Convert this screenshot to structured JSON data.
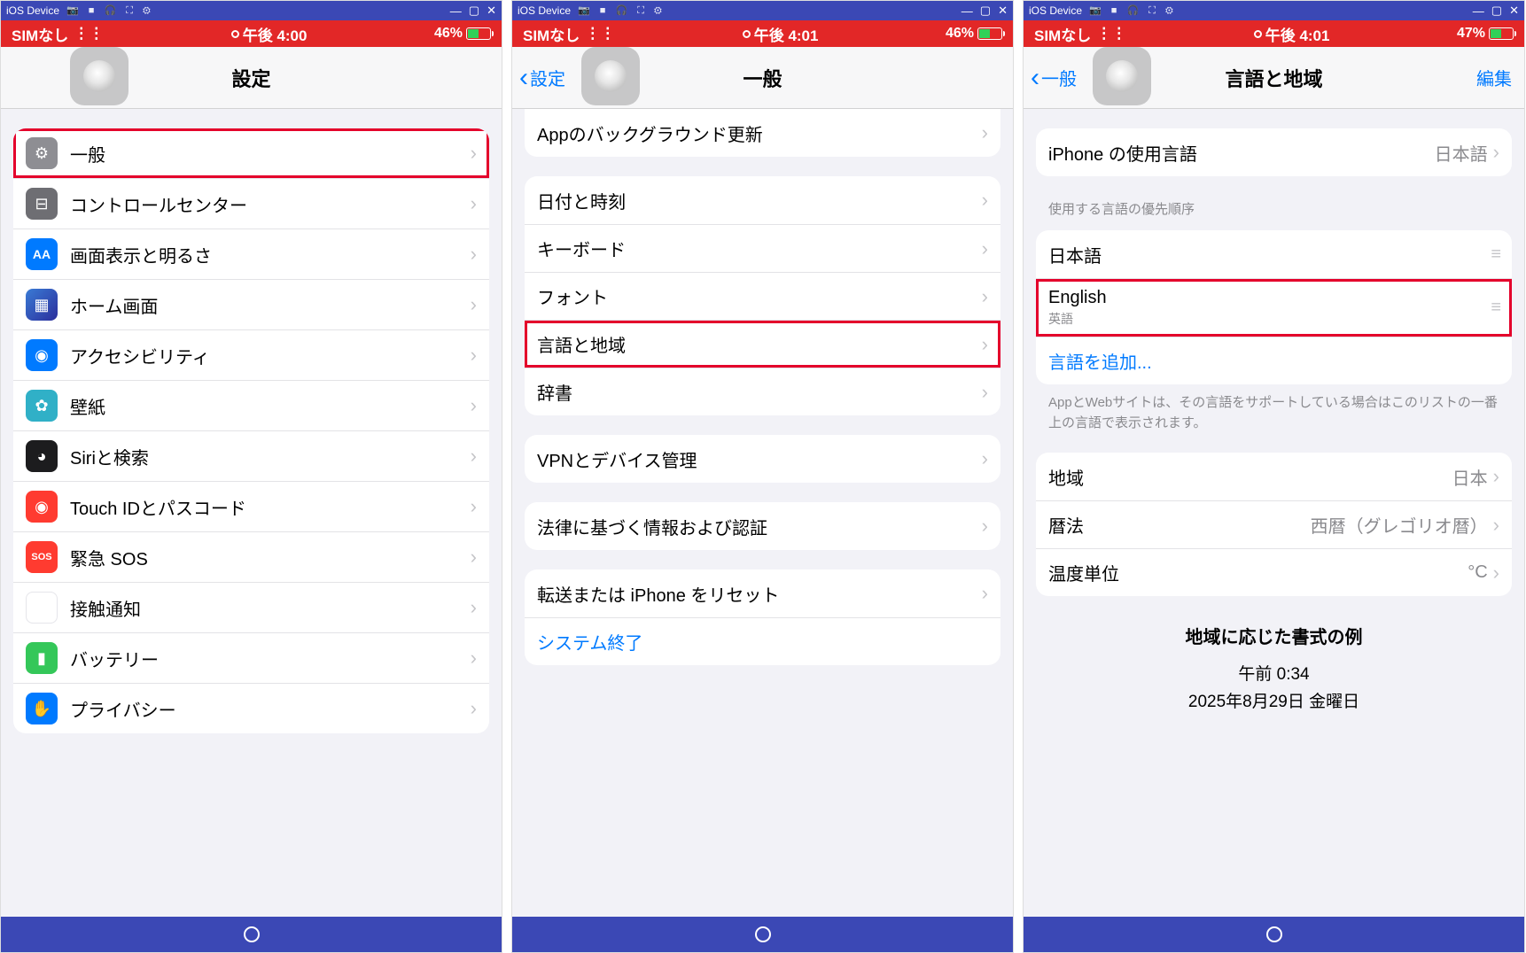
{
  "emulator": {
    "title": "iOS Device",
    "icons_glyphs": "📷 ■ 🎧 ⛶ ⚙",
    "win_min": "—",
    "win_max": "▢",
    "win_close": "✕"
  },
  "device1": {
    "status": {
      "sim": "SIMなし",
      "wifi": "􀙇",
      "time": "午後 4:00",
      "battery": "46%"
    },
    "nav": {
      "title": "設定"
    },
    "rows": [
      {
        "id": "general",
        "label": "一般",
        "icon_bg": "ic-gray",
        "glyph": "⚙",
        "hl": true
      },
      {
        "id": "control-center",
        "label": "コントロールセンター",
        "icon_bg": "ic-darkgray",
        "glyph": "⊟"
      },
      {
        "id": "display",
        "label": "画面表示と明るさ",
        "icon_bg": "ic-blue",
        "glyph": "AA"
      },
      {
        "id": "home-screen",
        "label": "ホーム画面",
        "icon_bg": "ic-apps",
        "glyph": "▦"
      },
      {
        "id": "accessibility",
        "label": "アクセシビリティ",
        "icon_bg": "ic-blue",
        "glyph": "◉"
      },
      {
        "id": "wallpaper",
        "label": "壁紙",
        "icon_bg": "ic-teal",
        "glyph": "✿"
      },
      {
        "id": "siri",
        "label": "Siriと検索",
        "icon_bg": "ic-black",
        "glyph": "◕"
      },
      {
        "id": "touchid",
        "label": "Touch IDとパスコード",
        "icon_bg": "ic-red",
        "glyph": "◉"
      },
      {
        "id": "sos",
        "label": "緊急 SOS",
        "icon_bg": "ic-sosred",
        "glyph": "SOS"
      },
      {
        "id": "exposure",
        "label": "接触通知",
        "icon_bg": "ic-exposure",
        "glyph": "⦿"
      },
      {
        "id": "battery",
        "label": "バッテリー",
        "icon_bg": "ic-green",
        "glyph": "▮"
      },
      {
        "id": "privacy",
        "label": "プライバシー",
        "icon_bg": "ic-blue",
        "glyph": "✋"
      }
    ]
  },
  "device2": {
    "status": {
      "sim": "SIMなし",
      "time": "午後 4:01",
      "battery": "46%"
    },
    "nav": {
      "back": "設定",
      "title": "一般"
    },
    "partial_row": "Appのバックグラウンド更新",
    "groupA": [
      {
        "id": "date-time",
        "label": "日付と時刻"
      },
      {
        "id": "keyboard",
        "label": "キーボード"
      },
      {
        "id": "fonts",
        "label": "フォント"
      },
      {
        "id": "language-region",
        "label": "言語と地域",
        "hl": true
      },
      {
        "id": "dictionary",
        "label": "辞書"
      }
    ],
    "groupB": [
      {
        "id": "vpn",
        "label": "VPNとデバイス管理"
      }
    ],
    "groupC": [
      {
        "id": "legal",
        "label": "法律に基づく情報および認証"
      }
    ],
    "groupD": [
      {
        "id": "transfer-reset",
        "label": "転送または iPhone をリセット"
      },
      {
        "id": "shutdown",
        "label": "システム終了",
        "link": true
      }
    ]
  },
  "device3": {
    "status": {
      "sim": "SIMなし",
      "time": "午後 4:01",
      "battery": "47%"
    },
    "nav": {
      "back": "一般",
      "title": "言語と地域",
      "action": "編集"
    },
    "iphone_lang_label": "iPhone の使用言語",
    "iphone_lang_value": "日本語",
    "pref_header": "使用する言語の優先順序",
    "langs": [
      {
        "id": "ja",
        "label": "日本語",
        "sub": ""
      },
      {
        "id": "en",
        "label": "English",
        "sub": "英語",
        "hl": true
      }
    ],
    "add_lang": "言語を追加...",
    "pref_footer": "AppとWebサイトは、その言語をサポートしている場合はこのリストの一番上の言語で表示されます。",
    "region_rows": [
      {
        "id": "region",
        "label": "地域",
        "value": "日本"
      },
      {
        "id": "calendar",
        "label": "暦法",
        "value": "西暦（グレゴリオ暦）"
      },
      {
        "id": "temp",
        "label": "温度単位",
        "value": "°C"
      }
    ],
    "example": {
      "heading": "地域に応じた書式の例",
      "time": "午前 0:34",
      "date": "2025年8月29日 金曜日"
    }
  }
}
